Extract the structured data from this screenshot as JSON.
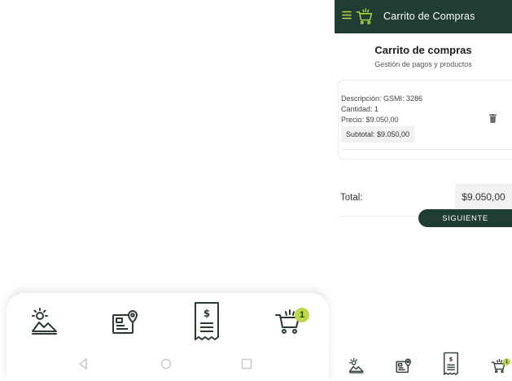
{
  "app_bar": {
    "title": "Carrito de Compras",
    "menu_icon": "hamburger-menu-icon",
    "logo_icon": "shopping-cart-icon",
    "background": "#1f3d31"
  },
  "page": {
    "title": "Carrito de compras",
    "subtitle": "Gestión de pagos y productos"
  },
  "cart_item": {
    "description": "Descripción: GSMI: 3286",
    "quantity": "Cantidad: 1",
    "price": "Precio: $9.050,00",
    "subtotal": "Subtotal: $9.050,00",
    "delete_icon": "trash-icon"
  },
  "total": {
    "label": "Total:",
    "value": "$9.050,00"
  },
  "actions": {
    "next_label": "SIGUIENTE"
  },
  "bottom_nav": {
    "items": [
      {
        "icon": "sunrise-landscape-icon"
      },
      {
        "icon": "map-pin-card-icon"
      },
      {
        "icon": "receipt-icon"
      },
      {
        "icon": "shopping-cart-icon"
      }
    ],
    "cart_badge": "1",
    "badge_color": "#b9d84a"
  },
  "system_nav": {
    "icons": [
      "back-icon",
      "home-icon",
      "recents-icon"
    ]
  }
}
